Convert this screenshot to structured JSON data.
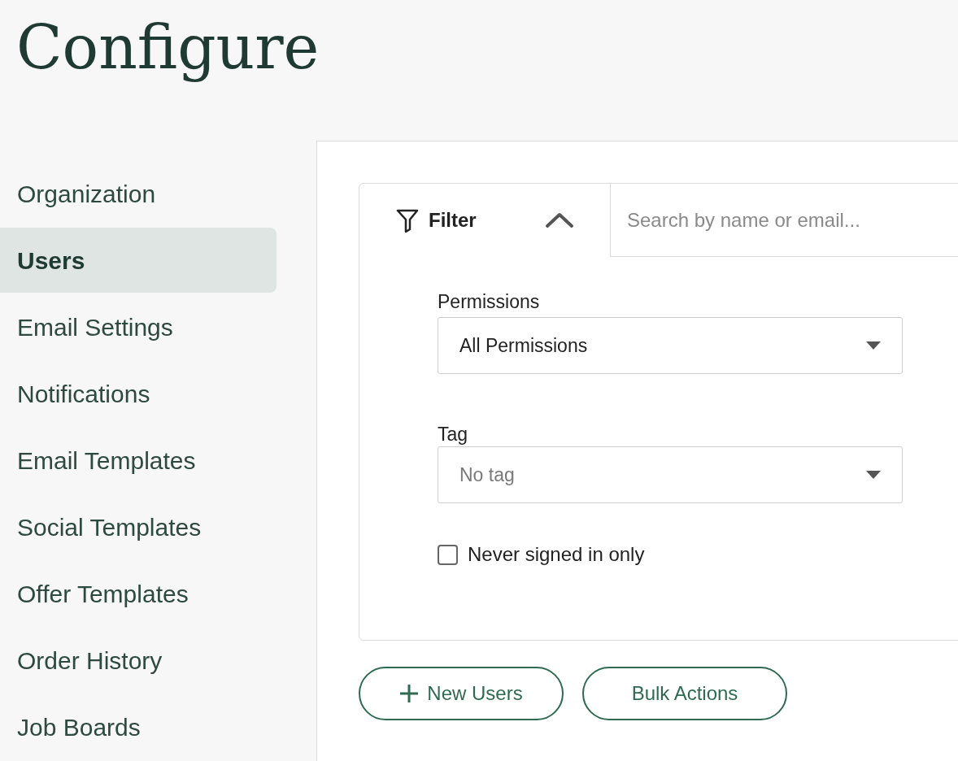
{
  "page_title": "Configure",
  "sidebar": {
    "items": [
      {
        "label": "Organization",
        "selected": false
      },
      {
        "label": "Users",
        "selected": true
      },
      {
        "label": "Email Settings",
        "selected": false
      },
      {
        "label": "Notifications",
        "selected": false
      },
      {
        "label": "Email Templates",
        "selected": false
      },
      {
        "label": "Social Templates",
        "selected": false
      },
      {
        "label": "Offer Templates",
        "selected": false
      },
      {
        "label": "Order History",
        "selected": false
      },
      {
        "label": "Job Boards",
        "selected": false
      }
    ]
  },
  "filter": {
    "label": "Filter",
    "expanded": true
  },
  "search": {
    "placeholder": "Search by name or email..."
  },
  "permissions": {
    "label": "Permissions",
    "value": "All Permissions"
  },
  "tag": {
    "label": "Tag",
    "placeholder": "No tag"
  },
  "never_signed_in": {
    "label": "Never signed in only",
    "checked": false
  },
  "buttons": [
    {
      "label": "New Users",
      "kind": "add"
    },
    {
      "label": "Bulk Actions",
      "kind": "plain"
    }
  ]
}
